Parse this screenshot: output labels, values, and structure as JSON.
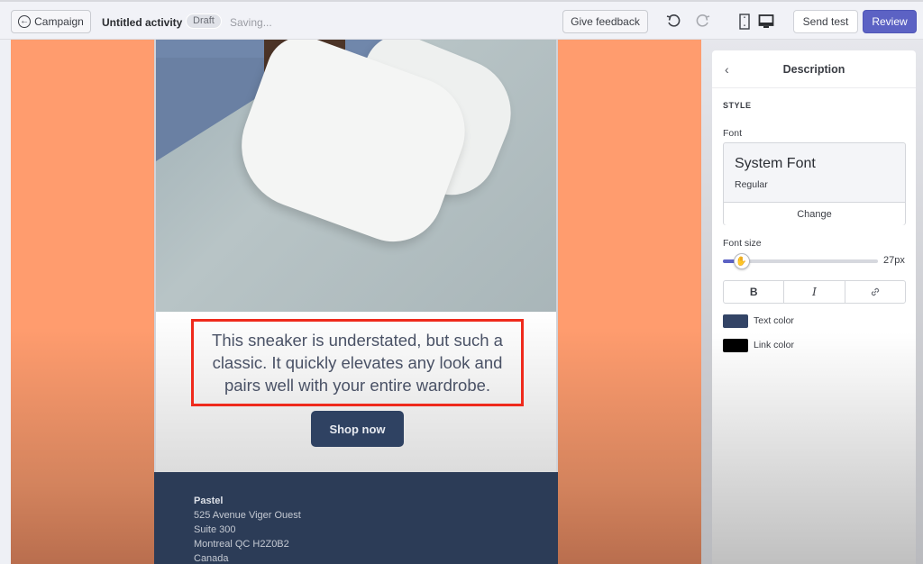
{
  "topbar": {
    "back_label": "Campaign",
    "title": "Untitled activity",
    "status_badge": "Draft",
    "saving_text": "Saving...",
    "feedback_label": "Give feedback",
    "send_test_label": "Send test",
    "review_label": "Review",
    "active_view": "desktop",
    "icons": [
      "arrow-left-circle-icon",
      "undo-icon",
      "redo-icon",
      "mobile-view-icon",
      "desktop-view-icon"
    ]
  },
  "email": {
    "hero_image_alt": "white sneakers on grey floor",
    "description": "This sneaker is understated, but such a classic. It quickly elevates any look and pairs well with your entire wardrobe.",
    "cta_label": "Shop now",
    "footer": {
      "name": "Pastel",
      "address_lines": [
        "525 Avenue Viger Ouest",
        "Suite 300",
        "Montreal QC H2Z0B2",
        "Canada"
      ]
    },
    "colors": {
      "background": "#ff9c6e",
      "cta": "#2f4262",
      "footer": "#2c3c57",
      "selection_outline": "#ef2a1c"
    }
  },
  "panel": {
    "back_icon": "chevron-left-icon",
    "title": "Description",
    "section_label": "STYLE",
    "font_label": "Font",
    "font_name": "System Font",
    "font_weight": "Regular",
    "change_label": "Change",
    "font_size_label": "Font size",
    "font_size_value": "27px",
    "font_size_fraction": 0.12,
    "format_buttons": [
      {
        "label": "B",
        "name": "bold"
      },
      {
        "label": "I",
        "name": "italic"
      },
      {
        "label": "🔗",
        "name": "link"
      }
    ],
    "text_color_label": "Text color",
    "text_color": "#334466",
    "link_color_label": "Link color",
    "link_color": "#000000",
    "accent": "#5c62c4"
  }
}
